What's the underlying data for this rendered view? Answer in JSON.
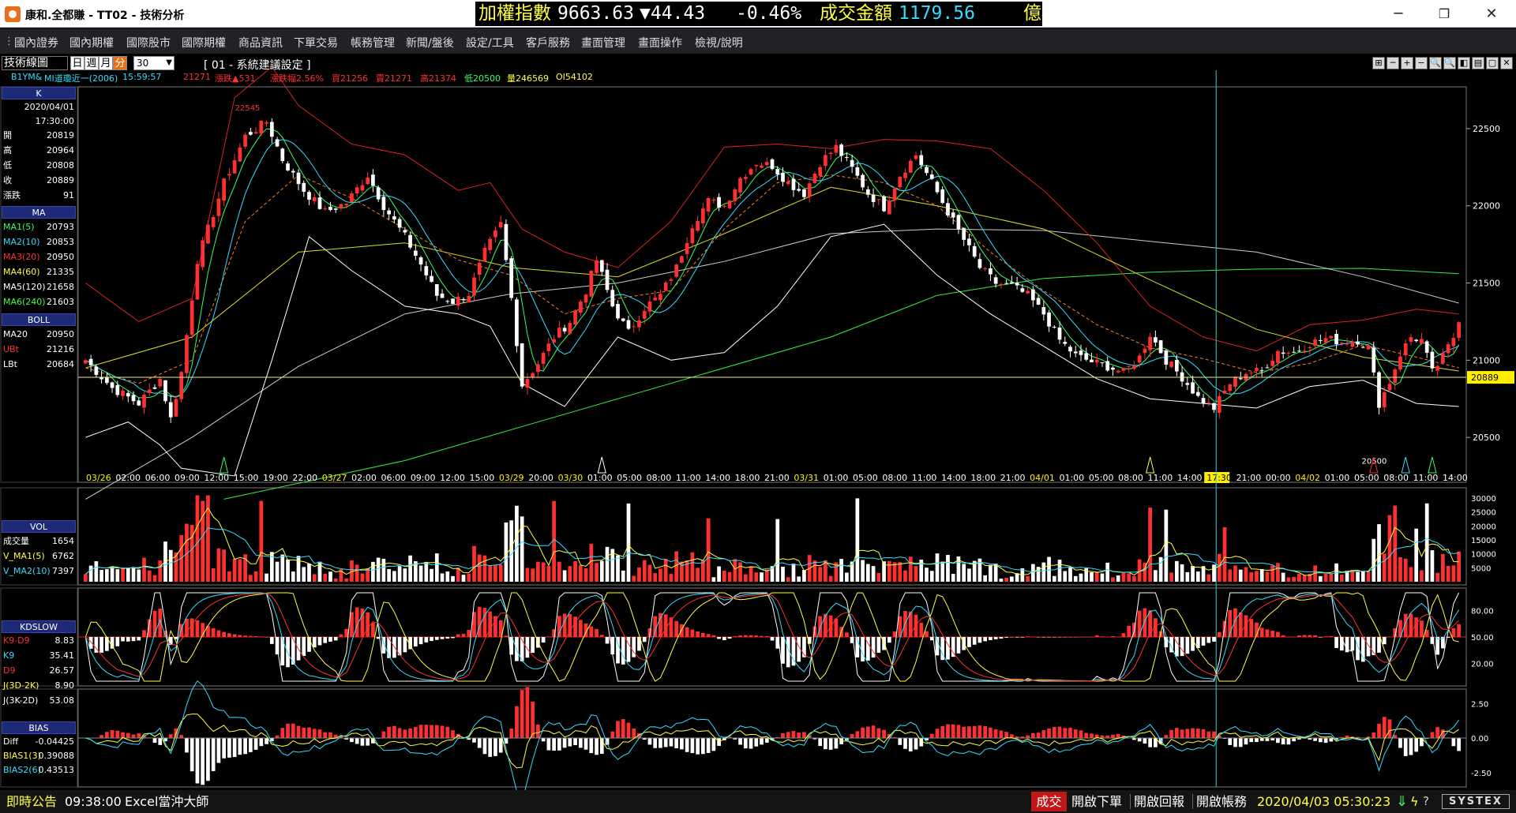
{
  "window": {
    "title": "康和.全都賺 - TT02 - 技術分析",
    "minimize": "─",
    "restore": "❐",
    "close": "✕"
  },
  "ticker": {
    "label": "加權指數",
    "value": "9663.63",
    "change": "▼44.43",
    "pct": "-0.46%",
    "amount_label": "成交金額",
    "amount": "1179.56",
    "unit": "億"
  },
  "menu": [
    "國內證券",
    "國內期權",
    "國際股市",
    "國際期權",
    "商品資訊",
    "下單交易",
    "帳務管理",
    "新聞/盤後",
    "設定/工具",
    "客戶服務",
    "畫面管理",
    "畫面操作",
    "檢視/說明"
  ],
  "chart_window": {
    "label": "技術線圖",
    "period_tabs": [
      "日",
      "週",
      "月",
      "分"
    ],
    "active_tab": "分",
    "minutes": "30",
    "system_setting": "[ 01 - 系統建議設定 ]",
    "toolbar_icons": [
      "⊞",
      "─",
      "+",
      "−",
      "🔍",
      "🔍",
      "◧",
      "▤",
      "▢",
      "✕"
    ]
  },
  "infoline": {
    "symbol": "B1YM&",
    "name": "MI道瓊近一(2006)",
    "time": "15:59:57",
    "price": "21271",
    "chg_label": "漲跌▲531",
    "pct_label": "漲跌幅2.56%",
    "buy": "買21256",
    "sell": "賣21271",
    "high": "高21374",
    "low": "低20500",
    "vol": "量246569",
    "oi": "OI54102"
  },
  "left_panel": {
    "k_header": "K",
    "date": "2020/04/01",
    "time": "17:30:00",
    "ohlc": [
      {
        "label": "開",
        "value": "20819"
      },
      {
        "label": "高",
        "value": "20964"
      },
      {
        "label": "低",
        "value": "20808"
      },
      {
        "label": "收",
        "value": "20889"
      },
      {
        "label": "漲跌",
        "value": "91"
      }
    ],
    "ma_header": "MA",
    "ma": [
      {
        "label": "MA1(5)",
        "value": "20793",
        "color": "#33ff66"
      },
      {
        "label": "MA2(10)",
        "value": "20853",
        "color": "#33ddff"
      },
      {
        "label": "MA3(20)",
        "value": "20950",
        "color": "#ff3030"
      },
      {
        "label": "MA4(60)",
        "value": "21335",
        "color": "#ffff44"
      },
      {
        "label": "MA5(120)",
        "value": "21658",
        "color": "#ffffff"
      },
      {
        "label": "MA6(240)",
        "value": "21603",
        "color": "#44ff44"
      }
    ],
    "boll_header": "BOLL",
    "boll": [
      {
        "label": "MA20",
        "value": "20950",
        "color": "#ffffff"
      },
      {
        "label": "UBt",
        "value": "21216",
        "color": "#ff3030"
      },
      {
        "label": "LBt",
        "value": "20684",
        "color": "#ffffff"
      }
    ],
    "vol_header": "VOL",
    "vol": [
      {
        "label": "成交量",
        "value": "1654",
        "color": "#ffffff"
      },
      {
        "label": "V_MA1(5)",
        "value": "6762",
        "color": "#ffff44"
      },
      {
        "label": "V_MA2(10)",
        "value": "7397",
        "color": "#33ddff"
      }
    ],
    "kd_header": "KDSLOW",
    "kd": [
      {
        "label": "K9-D9",
        "value": "8.83",
        "color": "#ff3030"
      },
      {
        "label": "K9",
        "value": "35.41",
        "color": "#33ddff"
      },
      {
        "label": "D9",
        "value": "26.57",
        "color": "#ff3030"
      },
      {
        "label": "J(3D-2K)",
        "value": "8.90",
        "color": "#ffff44"
      },
      {
        "label": "J(3K-2D)",
        "value": "53.08",
        "color": "#ffffff"
      }
    ],
    "bias_header": "BIAS",
    "bias": [
      {
        "label": "Diff",
        "value": "-0.04425",
        "color": "#ffffff"
      },
      {
        "label": "BIAS1(3)",
        "value": "0.39088",
        "color": "#ffff44"
      },
      {
        "label": "BIAS2(6)",
        "value": "0.43513",
        "color": "#33ddff"
      }
    ]
  },
  "status": {
    "notice": "即時公告",
    "time": "09:38:00",
    "excel": "Excel當沖大師",
    "trade": "成交",
    "open_order": "開啟下單",
    "open_report": "開啟回報",
    "open_account": "開啟帳務",
    "datetime": "2020/04/03 05:30:23",
    "logo": "SYSTEX"
  },
  "chart_data": {
    "type": "candlestick",
    "price_axis": {
      "ticks": [
        20500,
        21000,
        21500,
        22000,
        22500
      ],
      "range": [
        20240,
        22740
      ]
    },
    "current_price_label": "20889",
    "current_price": 20889,
    "high_label": "22545",
    "low_label": "20500",
    "cursor_time": "17:30",
    "time_labels": [
      "03/26",
      "02:00",
      "06:00",
      "09:00",
      "12:00",
      "15:00",
      "19:00",
      "22:00",
      "03/27",
      "02:00",
      "06:00",
      "09:00",
      "12:00",
      "15:00",
      "03/29",
      "20:00",
      "03/30",
      "01:00",
      "05:00",
      "08:00",
      "11:00",
      "14:00",
      "18:00",
      "21:00",
      "03/31",
      "01:00",
      "05:00",
      "08:00",
      "11:00",
      "14:00",
      "18:00",
      "21:00",
      "04/01",
      "01:00",
      "05:00",
      "08:00",
      "11:00",
      "14:00",
      "17:30",
      "21:00",
      "00:00",
      "04/02",
      "01:00",
      "05:00",
      "08:00",
      "11:00",
      "14:00"
    ],
    "keypoints": [
      [
        0,
        21000
      ],
      [
        5,
        20820
      ],
      [
        10,
        20720
      ],
      [
        14,
        20880
      ],
      [
        16,
        20620
      ],
      [
        18,
        20920
      ],
      [
        21,
        21650
      ],
      [
        26,
        22150
      ],
      [
        30,
        22450
      ],
      [
        34,
        22545
      ],
      [
        37,
        22300
      ],
      [
        41,
        22100
      ],
      [
        45,
        21960
      ],
      [
        49,
        22020
      ],
      [
        53,
        22200
      ],
      [
        56,
        22000
      ],
      [
        60,
        21800
      ],
      [
        63,
        21620
      ],
      [
        66,
        21420
      ],
      [
        69,
        21380
      ],
      [
        72,
        21430
      ],
      [
        75,
        21700
      ],
      [
        78,
        21880
      ],
      [
        80,
        21400
      ],
      [
        82,
        20840
      ],
      [
        85,
        20980
      ],
      [
        88,
        21150
      ],
      [
        91,
        21250
      ],
      [
        94,
        21450
      ],
      [
        96,
        21650
      ],
      [
        99,
        21350
      ],
      [
        102,
        21180
      ],
      [
        105,
        21340
      ],
      [
        108,
        21420
      ],
      [
        111,
        21600
      ],
      [
        114,
        21880
      ],
      [
        117,
        22030
      ],
      [
        120,
        22000
      ],
      [
        123,
        22180
      ],
      [
        126,
        22280
      ],
      [
        129,
        22260
      ],
      [
        132,
        22150
      ],
      [
        135,
        22080
      ],
      [
        138,
        22280
      ],
      [
        141,
        22380
      ],
      [
        144,
        22240
      ],
      [
        147,
        22080
      ],
      [
        150,
        21990
      ],
      [
        153,
        22200
      ],
      [
        156,
        22330
      ],
      [
        159,
        22150
      ],
      [
        162,
        21960
      ],
      [
        165,
        21780
      ],
      [
        168,
        21600
      ],
      [
        171,
        21500
      ],
      [
        174,
        21480
      ],
      [
        177,
        21420
      ],
      [
        180,
        21300
      ],
      [
        183,
        21130
      ],
      [
        186,
        21030
      ],
      [
        189,
        20990
      ],
      [
        192,
        20960
      ],
      [
        195,
        20920
      ],
      [
        198,
        21020
      ],
      [
        200,
        21170
      ],
      [
        203,
        21000
      ],
      [
        206,
        20890
      ],
      [
        209,
        20760
      ],
      [
        212,
        20690
      ],
      [
        215,
        20850
      ],
      [
        218,
        20920
      ],
      [
        221,
        20930
      ],
      [
        224,
        21060
      ],
      [
        227,
        21050
      ],
      [
        230,
        21110
      ],
      [
        233,
        21140
      ],
      [
        236,
        21120
      ],
      [
        239,
        21130
      ],
      [
        241,
        21080
      ],
      [
        243,
        20720
      ],
      [
        245,
        20860
      ],
      [
        247,
        21040
      ],
      [
        249,
        21150
      ],
      [
        251,
        21130
      ],
      [
        253,
        20920
      ],
      [
        255,
        21020
      ],
      [
        257,
        21150
      ],
      [
        258,
        21271
      ]
    ],
    "candle_count": 259,
    "band_lines": {
      "BOLL_UB": [
        [
          0,
          21500
        ],
        [
          10,
          21250
        ],
        [
          20,
          21400
        ],
        [
          28,
          22700
        ],
        [
          35,
          22900
        ],
        [
          40,
          22650
        ],
        [
          50,
          22400
        ],
        [
          60,
          22330
        ],
        [
          70,
          22100
        ],
        [
          76,
          22150
        ],
        [
          82,
          21850
        ],
        [
          90,
          21700
        ],
        [
          100,
          21600
        ],
        [
          110,
          21900
        ],
        [
          120,
          22380
        ],
        [
          130,
          22400
        ],
        [
          140,
          22370
        ],
        [
          150,
          22430
        ],
        [
          160,
          22420
        ],
        [
          170,
          22370
        ],
        [
          180,
          22100
        ],
        [
          190,
          21760
        ],
        [
          200,
          21350
        ],
        [
          210,
          21150
        ],
        [
          220,
          21060
        ],
        [
          230,
          21230
        ],
        [
          240,
          21260
        ],
        [
          250,
          21330
        ],
        [
          258,
          21300
        ]
      ],
      "BOLL_LB": [
        [
          0,
          20500
        ],
        [
          8,
          20600
        ],
        [
          14,
          20450
        ],
        [
          18,
          20300
        ],
        [
          28,
          20250
        ],
        [
          35,
          21000
        ],
        [
          42,
          21800
        ],
        [
          50,
          21580
        ],
        [
          60,
          21350
        ],
        [
          70,
          21300
        ],
        [
          76,
          21220
        ],
        [
          82,
          20850
        ],
        [
          90,
          20700
        ],
        [
          100,
          21150
        ],
        [
          110,
          21000
        ],
        [
          120,
          21050
        ],
        [
          130,
          21350
        ],
        [
          140,
          21800
        ],
        [
          150,
          21880
        ],
        [
          160,
          21550
        ],
        [
          170,
          21300
        ],
        [
          180,
          21090
        ],
        [
          190,
          20880
        ],
        [
          200,
          20750
        ],
        [
          210,
          20720
        ],
        [
          220,
          20690
        ],
        [
          230,
          20830
        ],
        [
          240,
          20870
        ],
        [
          250,
          20720
        ],
        [
          258,
          20700
        ]
      ],
      "MA120": [
        [
          0,
          20100
        ],
        [
          20,
          20500
        ],
        [
          40,
          20960
        ],
        [
          60,
          21300
        ],
        [
          80,
          21430
        ],
        [
          100,
          21500
        ],
        [
          120,
          21640
        ],
        [
          140,
          21820
        ],
        [
          160,
          21850
        ],
        [
          180,
          21840
        ],
        [
          200,
          21770
        ],
        [
          220,
          21700
        ],
        [
          240,
          21540
        ],
        [
          258,
          21370
        ]
      ],
      "MA240": [
        [
          26,
          20100
        ],
        [
          60,
          20350
        ],
        [
          100,
          20750
        ],
        [
          140,
          21150
        ],
        [
          160,
          21420
        ],
        [
          180,
          21530
        ],
        [
          200,
          21570
        ],
        [
          220,
          21590
        ],
        [
          240,
          21595
        ],
        [
          258,
          21560
        ]
      ],
      "MA60": [
        [
          0,
          20950
        ],
        [
          20,
          21150
        ],
        [
          40,
          21700
        ],
        [
          60,
          21760
        ],
        [
          80,
          21600
        ],
        [
          100,
          21540
        ],
        [
          120,
          21820
        ],
        [
          140,
          22120
        ],
        [
          160,
          22000
        ],
        [
          180,
          21850
        ],
        [
          200,
          21520
        ],
        [
          220,
          21200
        ],
        [
          240,
          21020
        ],
        [
          258,
          20930
        ]
      ],
      "MA20": [
        [
          0,
          20950
        ],
        [
          10,
          20850
        ],
        [
          20,
          21000
        ],
        [
          30,
          21900
        ],
        [
          40,
          22200
        ],
        [
          50,
          22050
        ],
        [
          60,
          21850
        ],
        [
          70,
          21650
        ],
        [
          80,
          21550
        ],
        [
          90,
          21300
        ],
        [
          100,
          21400
        ],
        [
          110,
          21450
        ],
        [
          120,
          21850
        ],
        [
          130,
          22150
        ],
        [
          140,
          22200
        ],
        [
          150,
          22150
        ],
        [
          160,
          22000
        ],
        [
          170,
          21700
        ],
        [
          180,
          21450
        ],
        [
          190,
          21230
        ],
        [
          200,
          21080
        ],
        [
          210,
          21010
        ],
        [
          220,
          20920
        ],
        [
          230,
          20980
        ],
        [
          240,
          21100
        ],
        [
          250,
          21020
        ],
        [
          258,
          20950
        ]
      ]
    },
    "volume_axis": {
      "ticks": [
        5000,
        10000,
        15000,
        20000,
        25000,
        30000
      ],
      "max": 32000
    },
    "kd_axis": {
      "ticks": [
        20.0,
        50.0,
        80.0
      ]
    },
    "bias_axis": {
      "ticks": [
        2.5,
        0.0,
        -2.5
      ]
    }
  }
}
